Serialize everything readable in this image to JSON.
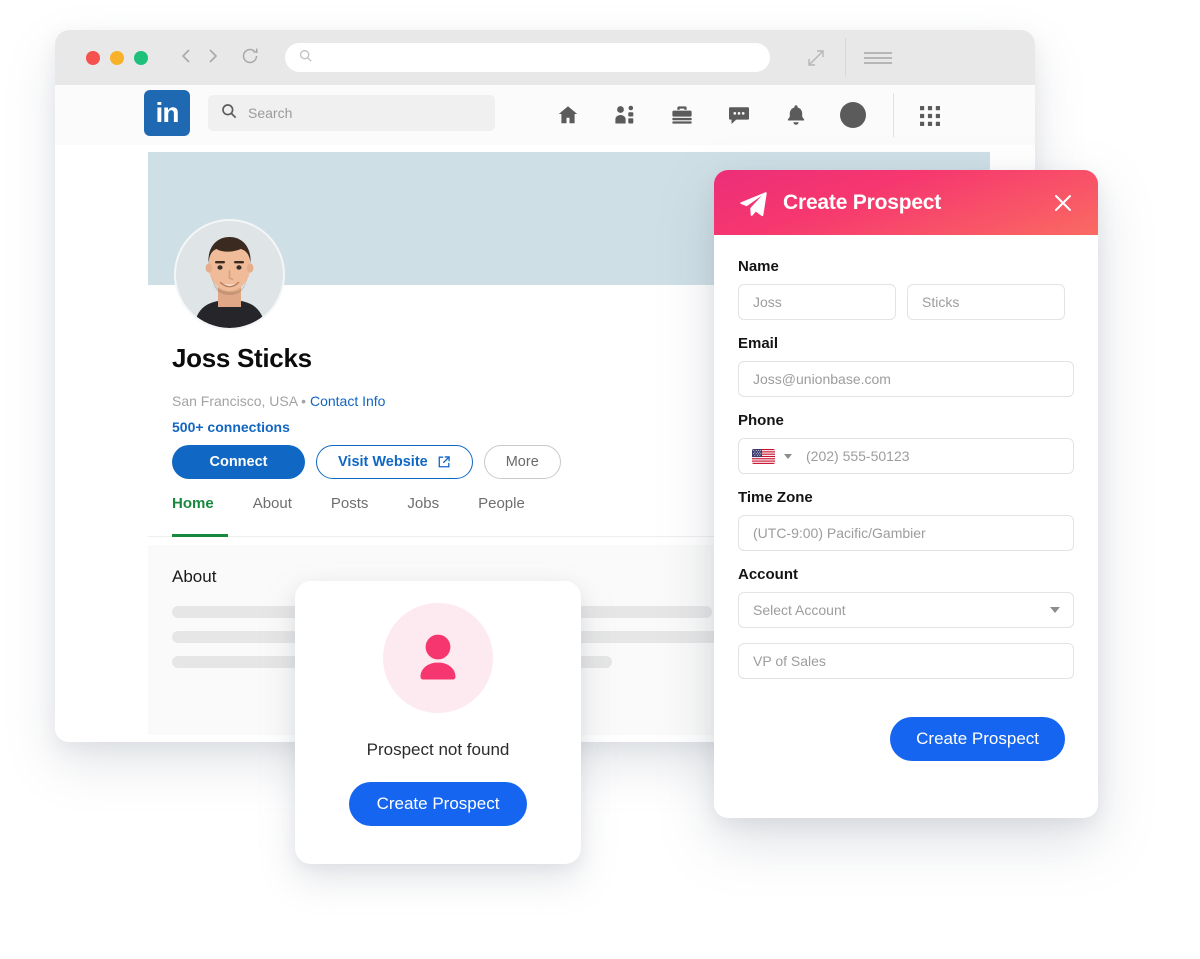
{
  "browser": {
    "traffic_lights": [
      "close-red",
      "minimize-yellow",
      "maximize-green"
    ],
    "back_icon": "chevron-left-icon",
    "forward_icon": "chevron-right-icon",
    "reload_icon": "reload-icon",
    "url_bar_value": "",
    "url_bar_icon": "search-icon",
    "expand_icon": "expand-arrows-icon",
    "menu_icon": "hamburger-menu-icon"
  },
  "linkedin": {
    "logo_text": "in",
    "search": {
      "placeholder": "Search",
      "icon": "search-icon"
    },
    "nav_items": [
      {
        "name": "home",
        "icon": "home-icon"
      },
      {
        "name": "my-network",
        "icon": "people-icon"
      },
      {
        "name": "jobs",
        "icon": "briefcase-icon"
      },
      {
        "name": "messaging",
        "icon": "chat-bubble-icon"
      },
      {
        "name": "notifications",
        "icon": "bell-icon"
      },
      {
        "name": "me",
        "icon": "avatar-icon"
      }
    ],
    "apps_icon": "grid-apps-icon"
  },
  "profile": {
    "name": "Joss Sticks",
    "location": "San Francisco, USA",
    "separator": "•",
    "contact_info_link": "Contact Info",
    "connections": "500+ connections",
    "actions": {
      "connect": "Connect",
      "visit_website": "Visit Website",
      "visit_website_icon": "external-link-icon",
      "more": "More"
    },
    "tabs": [
      {
        "label": "Home",
        "active": true
      },
      {
        "label": "About",
        "active": false
      },
      {
        "label": "Posts",
        "active": false
      },
      {
        "label": "Jobs",
        "active": false
      },
      {
        "label": "People",
        "active": false
      }
    ],
    "about_title": "About",
    "cover_color": "#cfdfe6",
    "accent_tab_color": "#17893e",
    "link_color": "#1266c2"
  },
  "prospect_card": {
    "icon": "person-icon",
    "message": "Prospect not found",
    "button_label": "Create Prospect",
    "icon_color": "#f6376f",
    "icon_bg_color": "#fdeaf0",
    "button_color": "#1565f0"
  },
  "create_prospect_panel": {
    "header": {
      "title": "Create Prospect",
      "icon": "paper-plane-icon",
      "close_icon": "close-x-icon",
      "gradient_from": "#ec2e78",
      "gradient_to": "#fa6a62"
    },
    "fields": {
      "name_label": "Name",
      "first_name_placeholder": "Joss",
      "last_name_placeholder": "Sticks",
      "email_label": "Email",
      "email_placeholder": "Joss@unionbase.com",
      "phone_label": "Phone",
      "phone_country_icon": "us-flag-icon",
      "phone_placeholder": "(202) 555-50123",
      "timezone_label": "Time Zone",
      "timezone_placeholder": "(UTC-9:00) Pacific/Gambier",
      "account_label": "Account",
      "account_placeholder": "Select Account",
      "account_dropdown_icon": "chevron-down-icon",
      "title_placeholder": "VP of Sales"
    },
    "submit_label": "Create Prospect",
    "submit_color": "#1565f0"
  }
}
